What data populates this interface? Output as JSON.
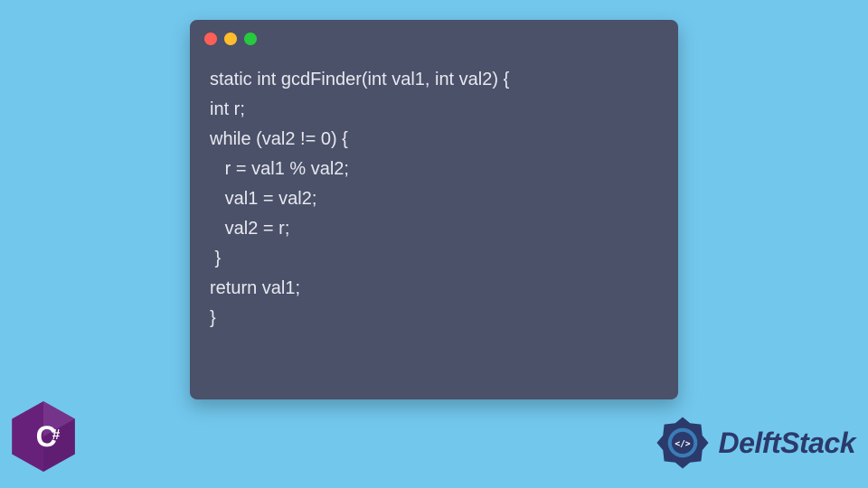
{
  "colors": {
    "page_bg": "#72c7ed",
    "window_bg": "#4a5169",
    "code_text": "#e8e8ef",
    "dot_red": "#ff5f56",
    "dot_yellow": "#ffbd2e",
    "dot_green": "#27c93f",
    "csharp_purple": "#68217a",
    "csharp_light": "#9a5eb0",
    "delftstack_blue": "#2b3a6b"
  },
  "code": {
    "line1": "static int gcdFinder(int val1, int val2) {",
    "line2": "int r;",
    "line3": "while (val2 != 0) {",
    "line4": "   r = val1 % val2;",
    "line5": "   val1 = val2;",
    "line6": "   val2 = r;",
    "line7": " }",
    "line8": "return val1;",
    "line9": "}"
  },
  "icons": {
    "csharp_label": "C#",
    "delftstack_label": "DelftStack"
  }
}
